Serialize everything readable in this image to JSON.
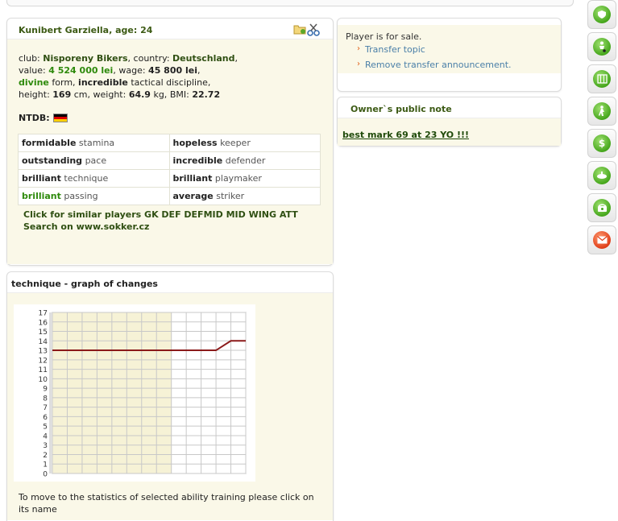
{
  "player": {
    "name": "Kunibert Garziella",
    "age_label": "age:",
    "age": "24",
    "club_label": "club:",
    "club": "Nisporeny Bikers",
    "country_label": "country:",
    "country": "Deutschland",
    "value_label": "value:",
    "value": "4 524 000 lei",
    "wage_label": "wage:",
    "wage": "45 800 lei",
    "form": "divine",
    "form_label": "form,",
    "tactical": "incredible",
    "tactical_label": "tactical discipline,",
    "height_label": "height:",
    "height": "169",
    "height_unit": "cm,",
    "weight_label": "weight:",
    "weight": "64.9",
    "weight_unit": "kg,",
    "bmi_label": "BMI:",
    "bmi": "22.72",
    "ntdb_label": "NTDB:",
    "skills": [
      {
        "level": "formidable",
        "skill": "stamina",
        "highlight": false
      },
      {
        "level": "hopeless",
        "skill": "keeper",
        "highlight": false
      },
      {
        "level": "outstanding",
        "skill": "pace",
        "highlight": false
      },
      {
        "level": "incredible",
        "skill": "defender",
        "highlight": false
      },
      {
        "level": "brilliant",
        "skill": "technique",
        "highlight": false
      },
      {
        "level": "brilliant",
        "skill": "playmaker",
        "highlight": false
      },
      {
        "level": "brilliant",
        "skill": "passing",
        "highlight": true
      },
      {
        "level": "average",
        "skill": "striker",
        "highlight": false
      }
    ],
    "similar_link": "Click for similar players GK DEF DEFMID MID WING ATT",
    "search_link": "Search on www.sokker.cz"
  },
  "sale": {
    "status": "Player is for sale.",
    "transfer_topic": "Transfer topic",
    "remove_announcement": "Remove transfer announcement."
  },
  "owner_note": {
    "title": "Owner`s public note",
    "text": "best mark 69 at 23 YO !!!"
  },
  "graph": {
    "title": "technique - graph of changes",
    "note": "To move to the statistics of selected ability training please click on its name"
  },
  "sidebar": {
    "icons": [
      "shield-icon",
      "player-icon",
      "tactics-icon",
      "walking-player-icon",
      "money-icon",
      "training-icon",
      "phone-icon",
      "mail-icon"
    ]
  },
  "colors": {
    "accent_green": "#2e8a0c",
    "dark_green": "#2f4f12",
    "link_blue": "#4a7fa8",
    "line_red": "#8b1a1a",
    "panel_bg": "#faf8e8"
  },
  "chart_data": {
    "type": "line",
    "title": "",
    "xlabel": "",
    "ylabel": "",
    "yticks": [
      0,
      1,
      2,
      3,
      4,
      5,
      6,
      7,
      8,
      9,
      10,
      11,
      12,
      13,
      14,
      15,
      16,
      17
    ],
    "ylim": [
      0,
      17
    ],
    "x": [
      0,
      1,
      2,
      3,
      4,
      5,
      6,
      7,
      8,
      9,
      10,
      11,
      12,
      13
    ],
    "xlim": [
      0,
      13
    ],
    "series": [
      {
        "name": "",
        "values": [
          13,
          13,
          13,
          13,
          13,
          13,
          13,
          13,
          13,
          13,
          13,
          13,
          14,
          14
        ]
      }
    ],
    "grid": true
  }
}
